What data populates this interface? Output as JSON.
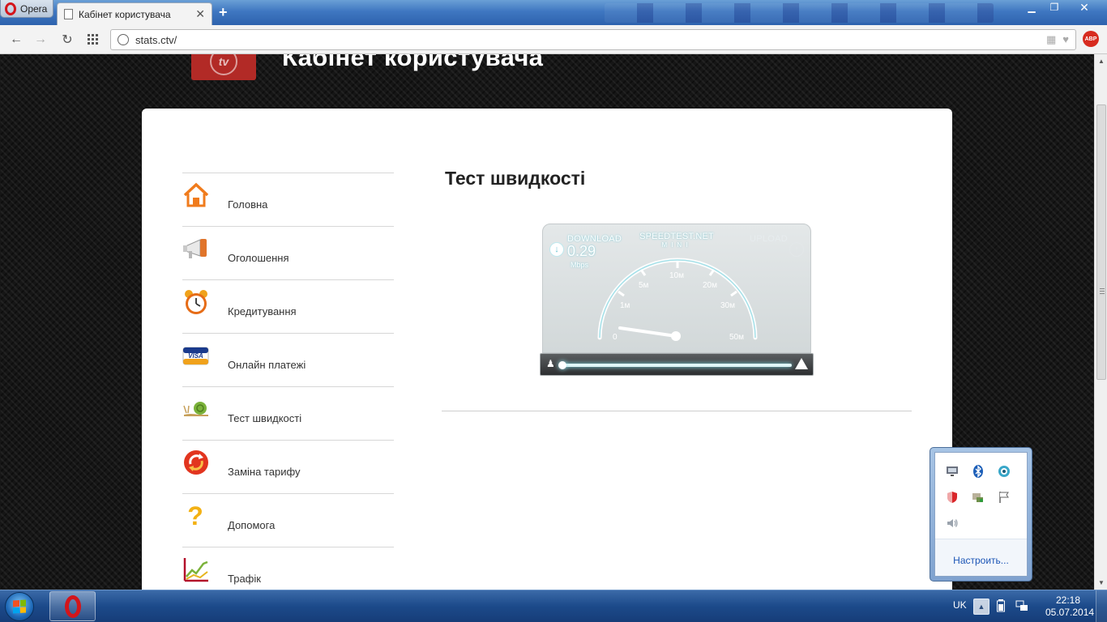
{
  "browser": {
    "menu_label": "Opera",
    "tab_title": "Кабінет користувача",
    "new_tab_symbol": "+",
    "url": "stats.ctv/",
    "adblock_label": "ABP"
  },
  "site": {
    "title": "Кабінет користувача",
    "logo_text": "tv",
    "brand_color": "#b22a26"
  },
  "menu": {
    "items": [
      {
        "label": "Головна",
        "icon": "home-icon"
      },
      {
        "label": "Оголошення",
        "icon": "megaphone-icon"
      },
      {
        "label": "Кредитування",
        "icon": "alarm-clock-icon"
      },
      {
        "label": "Онлайн платежі",
        "icon": "visa-card-icon"
      },
      {
        "label": "Тест швидкості",
        "icon": "snail-icon"
      },
      {
        "label": "Заміна тарифу",
        "icon": "tariff-change-icon"
      },
      {
        "label": "Допомога",
        "icon": "question-icon"
      },
      {
        "label": "Трафік",
        "icon": "traffic-chart-icon"
      }
    ]
  },
  "content": {
    "title": "Тест швидкості"
  },
  "speedtest": {
    "brand": "SPEEDTEST.NET",
    "brand_sub": "MINI",
    "download_label": "DOWNLOAD",
    "download_value": "0.29",
    "download_unit": "Mbps",
    "upload_label": "UPLOAD",
    "scale_labels": [
      "0",
      "1м",
      "5м",
      "10м",
      "20м",
      "30м",
      "50м"
    ]
  },
  "tray": {
    "icons": [
      "network-monitor-icon",
      "bluetooth-icon",
      "camera-icon",
      "shield-icon",
      "devices-icon",
      "flag-icon",
      "speaker-icon"
    ],
    "customize_label": "Настроить..."
  },
  "taskbar": {
    "language": "UK",
    "time": "22:18",
    "date": "05.07.2014"
  }
}
